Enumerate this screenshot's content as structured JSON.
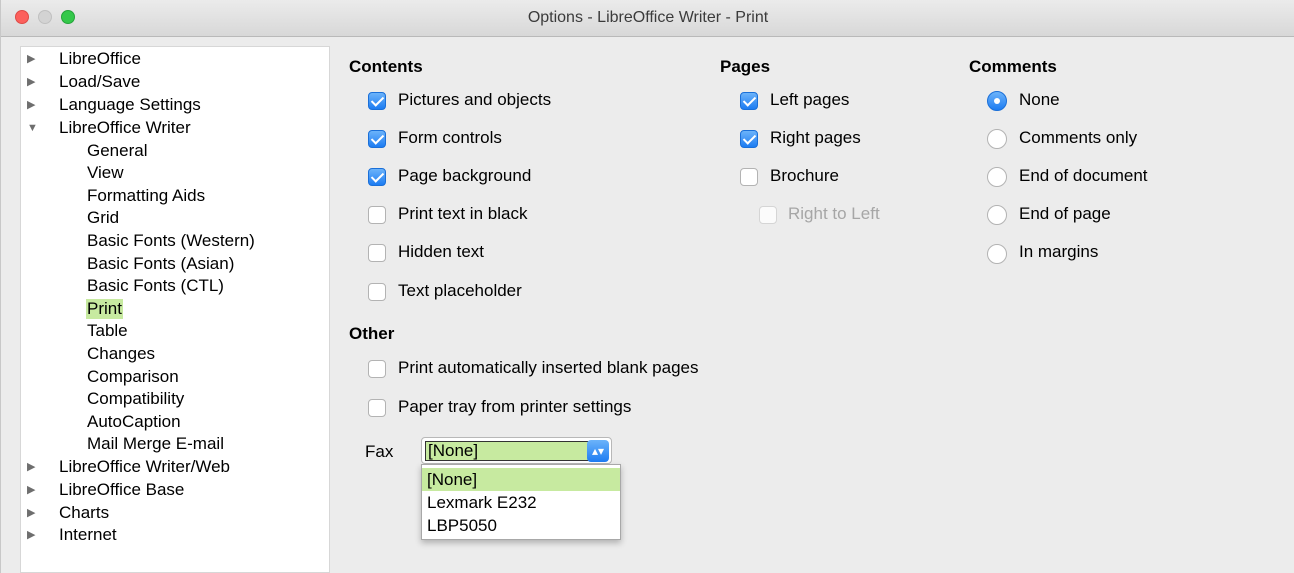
{
  "window": {
    "title": "Options - LibreOffice Writer - Print"
  },
  "tree": {
    "items": [
      {
        "label": "LibreOffice",
        "arrow": "▶"
      },
      {
        "label": "Load/Save",
        "arrow": "▶"
      },
      {
        "label": "Language Settings",
        "arrow": "▶"
      },
      {
        "label": "LibreOffice Writer",
        "arrow": "▼"
      },
      {
        "label": "General"
      },
      {
        "label": "View"
      },
      {
        "label": "Formatting Aids"
      },
      {
        "label": "Grid"
      },
      {
        "label": "Basic Fonts (Western)"
      },
      {
        "label": "Basic Fonts (Asian)"
      },
      {
        "label": "Basic Fonts (CTL)"
      },
      {
        "label": "Print"
      },
      {
        "label": "Table"
      },
      {
        "label": "Changes"
      },
      {
        "label": "Comparison"
      },
      {
        "label": "Compatibility"
      },
      {
        "label": "AutoCaption"
      },
      {
        "label": "Mail Merge E-mail"
      },
      {
        "label": "LibreOffice Writer/Web",
        "arrow": "▶"
      },
      {
        "label": "LibreOffice Base",
        "arrow": "▶"
      },
      {
        "label": "Charts",
        "arrow": "▶"
      },
      {
        "label": "Internet",
        "arrow": "▶"
      }
    ],
    "selected": "Print"
  },
  "contents": {
    "header": "Contents",
    "items": [
      {
        "label": "Pictures and objects",
        "checked": true
      },
      {
        "label": "Form controls",
        "checked": true
      },
      {
        "label": "Page background",
        "checked": true
      },
      {
        "label": "Print text in black",
        "checked": false
      },
      {
        "label": "Hidden text",
        "checked": false
      },
      {
        "label": "Text placeholder",
        "checked": false
      }
    ]
  },
  "pages": {
    "header": "Pages",
    "items": [
      {
        "label": "Left pages",
        "checked": true
      },
      {
        "label": "Right pages",
        "checked": true
      },
      {
        "label": "Brochure",
        "checked": false
      },
      {
        "label": "Right to Left",
        "checked": false,
        "disabled": true
      }
    ]
  },
  "comments": {
    "header": "Comments",
    "options": [
      {
        "label": "None",
        "selected": true
      },
      {
        "label": "Comments only",
        "selected": false
      },
      {
        "label": "End of document",
        "selected": false
      },
      {
        "label": "End of page",
        "selected": false
      },
      {
        "label": "In margins",
        "selected": false
      }
    ]
  },
  "other": {
    "header": "Other",
    "items": [
      {
        "label": "Print automatically inserted blank pages",
        "checked": false
      },
      {
        "label": "Paper tray from printer settings",
        "checked": false
      }
    ]
  },
  "fax": {
    "label": "Fax",
    "value": "[None]",
    "options": [
      "[None]",
      "Lexmark E232",
      "LBP5050"
    ]
  },
  "colors": {
    "accent": "#1d7cf2",
    "selection": "#c7eaa0"
  }
}
